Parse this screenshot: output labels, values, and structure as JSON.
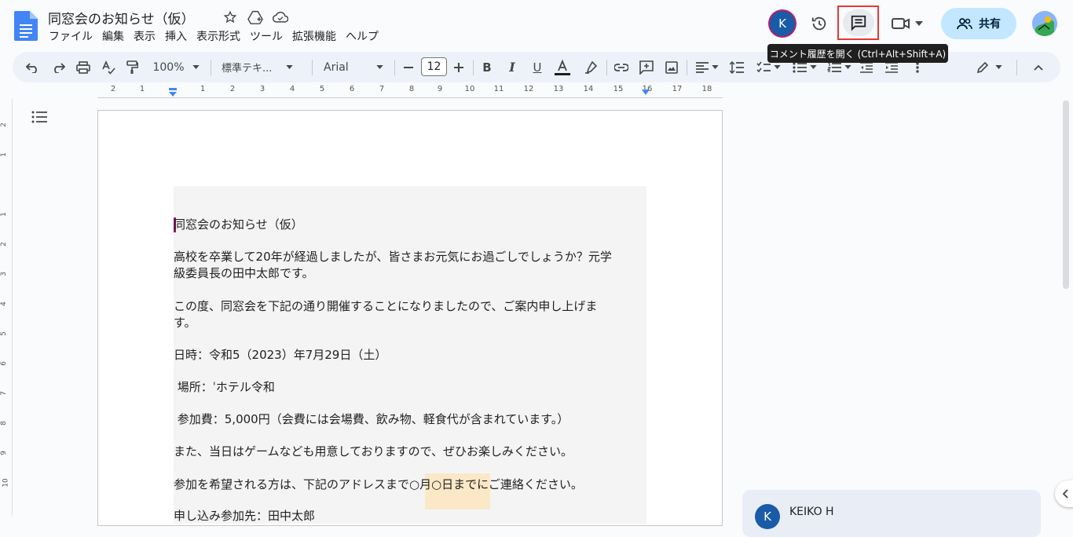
{
  "doc": {
    "title": "同窓会のお知らせ（仮）",
    "menu": [
      "ファイル",
      "編集",
      "表示",
      "挿入",
      "表示形式",
      "ツール",
      "拡張機能",
      "ヘルプ"
    ]
  },
  "header": {
    "user_initial": "K",
    "share_label": "共有",
    "tooltip": "コメント履歴を開く (Ctrl+Alt+Shift+A)"
  },
  "toolbar": {
    "zoom": "100%",
    "style": "標準テキ...",
    "font": "Arial",
    "font_size": "12",
    "text_color": "#1f1f1f"
  },
  "ruler": {
    "labels": [
      "2",
      "1",
      "1",
      "2",
      "3",
      "4",
      "5",
      "6",
      "7",
      "8",
      "9",
      "10",
      "11",
      "12",
      "13",
      "14",
      "15",
      "16",
      "17",
      "18"
    ]
  },
  "vruler": {
    "labels": [
      "2",
      "1",
      "1",
      "2",
      "3",
      "4",
      "5",
      "6",
      "7",
      "8",
      "9",
      "10"
    ]
  },
  "body": {
    "lines": [
      "同窓会のお知らせ（仮）",
      "高校を卒業して20年が経過しましたが、皆さまお元気にお過ごしでしょうか？元学",
      "級委員長の田中太郎です。",
      "この度、同窓会を下記の通り開催することになりましたので、ご案内申し上げま",
      "す。",
      "日時：令和5（2023）年7月29日（土）",
      " 場所：ˈホテル令和",
      " 参加費：5,000円（会費には会場費、飲み物、軽食代が含まれています。）",
      "また、当日はゲームなども用意しておりますので、ぜひお楽しみください。",
      "参加を希望される方は、下記のアドレスまで○月○日までにご連絡ください。",
      "申し込み参加先：田中太郎"
    ]
  },
  "comment": {
    "initial": "K",
    "name": "KEIKO H"
  },
  "colors": {
    "accent": "#1a5ba8",
    "share_bg": "#c2e7ff",
    "highlight": "#fbe8c6",
    "focus_outline": "#e53935"
  }
}
